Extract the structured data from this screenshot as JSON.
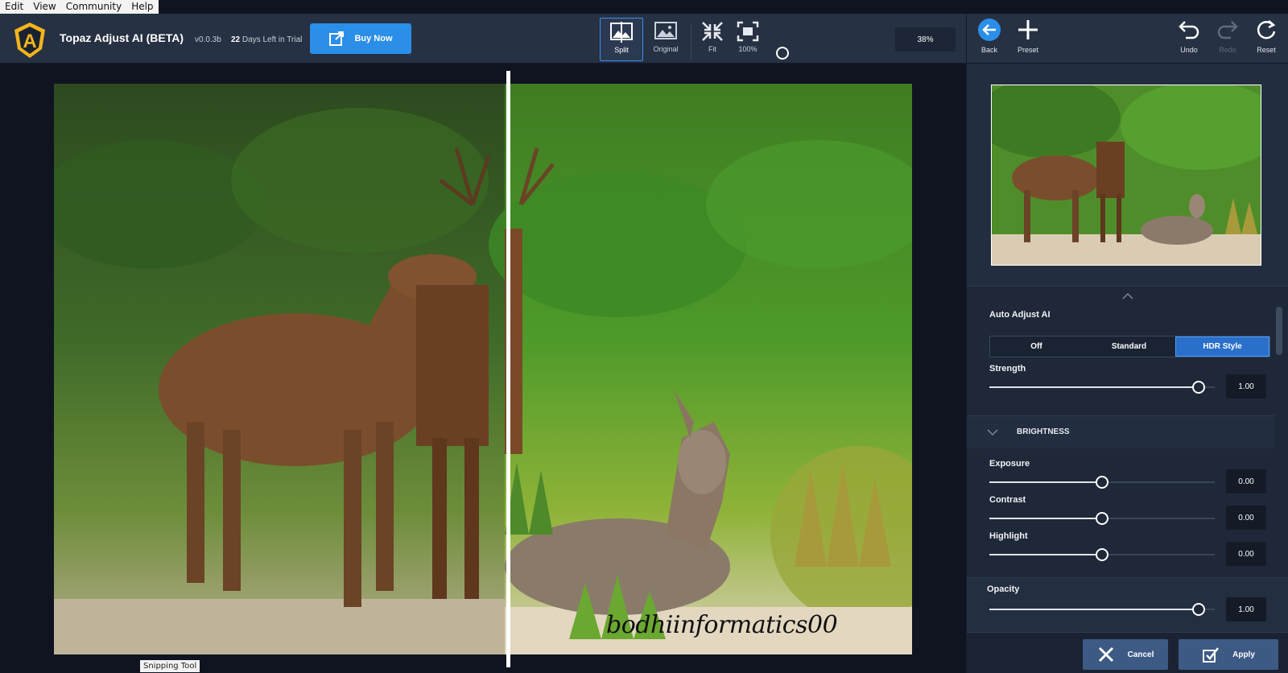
{
  "menu": [
    "Edit",
    "View",
    "Community",
    "Help"
  ],
  "header": {
    "app_title": "Topaz Adjust AI (BETA)",
    "version": "v0.0.3b",
    "trial_days": "22",
    "trial_text": "Days Left in Trial",
    "buy_label": "Buy Now"
  },
  "view_tools": {
    "split": "Split",
    "original": "Original",
    "fit": "Fit",
    "full": "100%",
    "zoom": "38%"
  },
  "right_toolbar": {
    "back": "Back",
    "preset": "Preset",
    "undo": "Undo",
    "redo": "Redo",
    "reset": "Reset"
  },
  "canvas": {
    "watermark": "bodhiinformatics00",
    "snipping_tooltip": "Snipping Tool"
  },
  "panel": {
    "auto_adjust_title": "Auto Adjust AI",
    "modes": [
      "Off",
      "Standard",
      "HDR Style"
    ],
    "active_mode": "HDR Style",
    "strength": {
      "label": "Strength",
      "value": "1.00",
      "level": 0.93
    },
    "brightness_section": "BRIGHTNESS",
    "exposure": {
      "label": "Exposure",
      "value": "0.00",
      "level": 0.5
    },
    "contrast": {
      "label": "Contrast",
      "value": "0.00",
      "level": 0.5
    },
    "highlight": {
      "label": "Highlight",
      "value": "0.00",
      "level": 0.5
    },
    "opacity": {
      "label": "Opacity",
      "value": "1.00",
      "level": 0.93
    }
  },
  "footer": {
    "cancel": "Cancel",
    "apply": "Apply"
  },
  "colors": {
    "accent": "#2b8ee8",
    "toolbar_bg": "#263143",
    "panel_bg": "#1e2838"
  }
}
